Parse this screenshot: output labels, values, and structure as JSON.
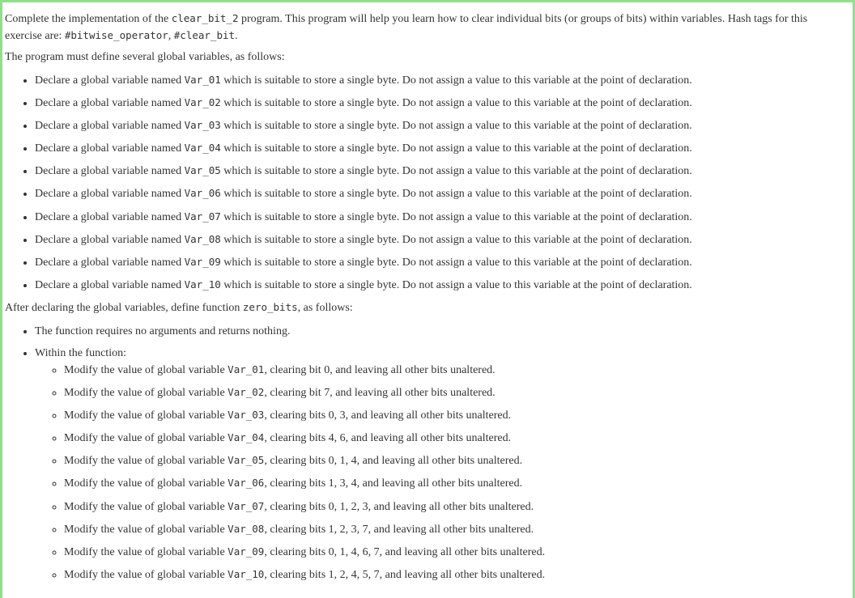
{
  "intro": {
    "t1": "Complete the implementation of the ",
    "code1": "clear_bit_2",
    "t2": " program. This program will help you learn how to clear individual bits (or groups of bits) within variables. Hash tags for this exercise are: ",
    "code2": "#bitwise_operator",
    "t3": ", ",
    "code3": "#clear_bit",
    "t4": "."
  },
  "globals_heading": "The program must define several global variables, as follows:",
  "globals": [
    {
      "pre": "Declare a global variable named ",
      "name": "Var_01",
      "post": " which is suitable to store a single byte. Do not assign a value to this variable at the point of declaration."
    },
    {
      "pre": "Declare a global variable named ",
      "name": "Var_02",
      "post": " which is suitable to store a single byte. Do not assign a value to this variable at the point of declaration."
    },
    {
      "pre": "Declare a global variable named ",
      "name": "Var_03",
      "post": " which is suitable to store a single byte. Do not assign a value to this variable at the point of declaration."
    },
    {
      "pre": "Declare a global variable named ",
      "name": "Var_04",
      "post": " which is suitable to store a single byte. Do not assign a value to this variable at the point of declaration."
    },
    {
      "pre": "Declare a global variable named ",
      "name": "Var_05",
      "post": " which is suitable to store a single byte. Do not assign a value to this variable at the point of declaration."
    },
    {
      "pre": "Declare a global variable named ",
      "name": "Var_06",
      "post": " which is suitable to store a single byte. Do not assign a value to this variable at the point of declaration."
    },
    {
      "pre": "Declare a global variable named ",
      "name": "Var_07",
      "post": " which is suitable to store a single byte. Do not assign a value to this variable at the point of declaration."
    },
    {
      "pre": "Declare a global variable named ",
      "name": "Var_08",
      "post": " which is suitable to store a single byte. Do not assign a value to this variable at the point of declaration."
    },
    {
      "pre": "Declare a global variable named ",
      "name": "Var_09",
      "post": " which is suitable to store a single byte. Do not assign a value to this variable at the point of declaration."
    },
    {
      "pre": "Declare a global variable named ",
      "name": "Var_10",
      "post": " which is suitable to store a single byte. Do not assign a value to this variable at the point of declaration."
    }
  ],
  "function_heading": {
    "t1": "After declaring the global variables, define function ",
    "code": "zero_bits",
    "t2": ", as follows:"
  },
  "function_items": {
    "no_args": "The function requires no arguments and returns nothing.",
    "within": "Within the function:"
  },
  "modifications": [
    {
      "pre": "Modify the value of global variable ",
      "name": "Var_01",
      "post": ", clearing bit 0, and leaving all other bits unaltered."
    },
    {
      "pre": "Modify the value of global variable ",
      "name": "Var_02",
      "post": ", clearing bit 7, and leaving all other bits unaltered."
    },
    {
      "pre": "Modify the value of global variable ",
      "name": "Var_03",
      "post": ", clearing bits 0, 3, and leaving all other bits unaltered."
    },
    {
      "pre": "Modify the value of global variable ",
      "name": "Var_04",
      "post": ", clearing bits 4, 6, and leaving all other bits unaltered."
    },
    {
      "pre": "Modify the value of global variable ",
      "name": "Var_05",
      "post": ", clearing bits 0, 1, 4, and leaving all other bits unaltered."
    },
    {
      "pre": "Modify the value of global variable ",
      "name": "Var_06",
      "post": ", clearing bits 1, 3, 4, and leaving all other bits unaltered."
    },
    {
      "pre": "Modify the value of global variable ",
      "name": "Var_07",
      "post": ", clearing bits 0, 1, 2, 3, and leaving all other bits unaltered."
    },
    {
      "pre": "Modify the value of global variable ",
      "name": "Var_08",
      "post": ", clearing bits 1, 2, 3, 7, and leaving all other bits unaltered."
    },
    {
      "pre": "Modify the value of global variable ",
      "name": "Var_09",
      "post": ", clearing bits 0, 1, 4, 6, 7, and leaving all other bits unaltered."
    },
    {
      "pre": "Modify the value of global variable ",
      "name": "Var_10",
      "post": ", clearing bits 1, 2, 4, 5, 7, and leaving all other bits unaltered."
    }
  ],
  "colors": {
    "border": "#90e08a",
    "text": "#333333"
  }
}
